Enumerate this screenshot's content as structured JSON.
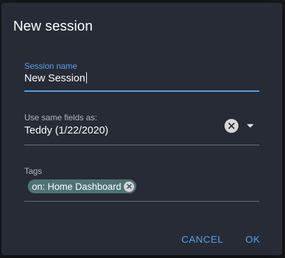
{
  "dialog": {
    "title": "New session"
  },
  "fields": {
    "session_name": {
      "label": "Session name",
      "value": "New Session"
    },
    "same_fields": {
      "label": "Use same fields as:",
      "value": "Teddy (1/22/2020)",
      "clear_icon": "clear-circle-icon",
      "dropdown_icon": "arrow-drop-down-icon"
    },
    "tags": {
      "label": "Tags",
      "chips": [
        {
          "label": "on: Home Dashboard",
          "delete_icon": "cancel-circle-icon"
        }
      ]
    }
  },
  "actions": {
    "cancel_label": "CANCEL",
    "ok_label": "OK"
  },
  "colors": {
    "dialog_background": "#262b35",
    "accent": "#5aa2ea",
    "chip_background": "#507277"
  }
}
